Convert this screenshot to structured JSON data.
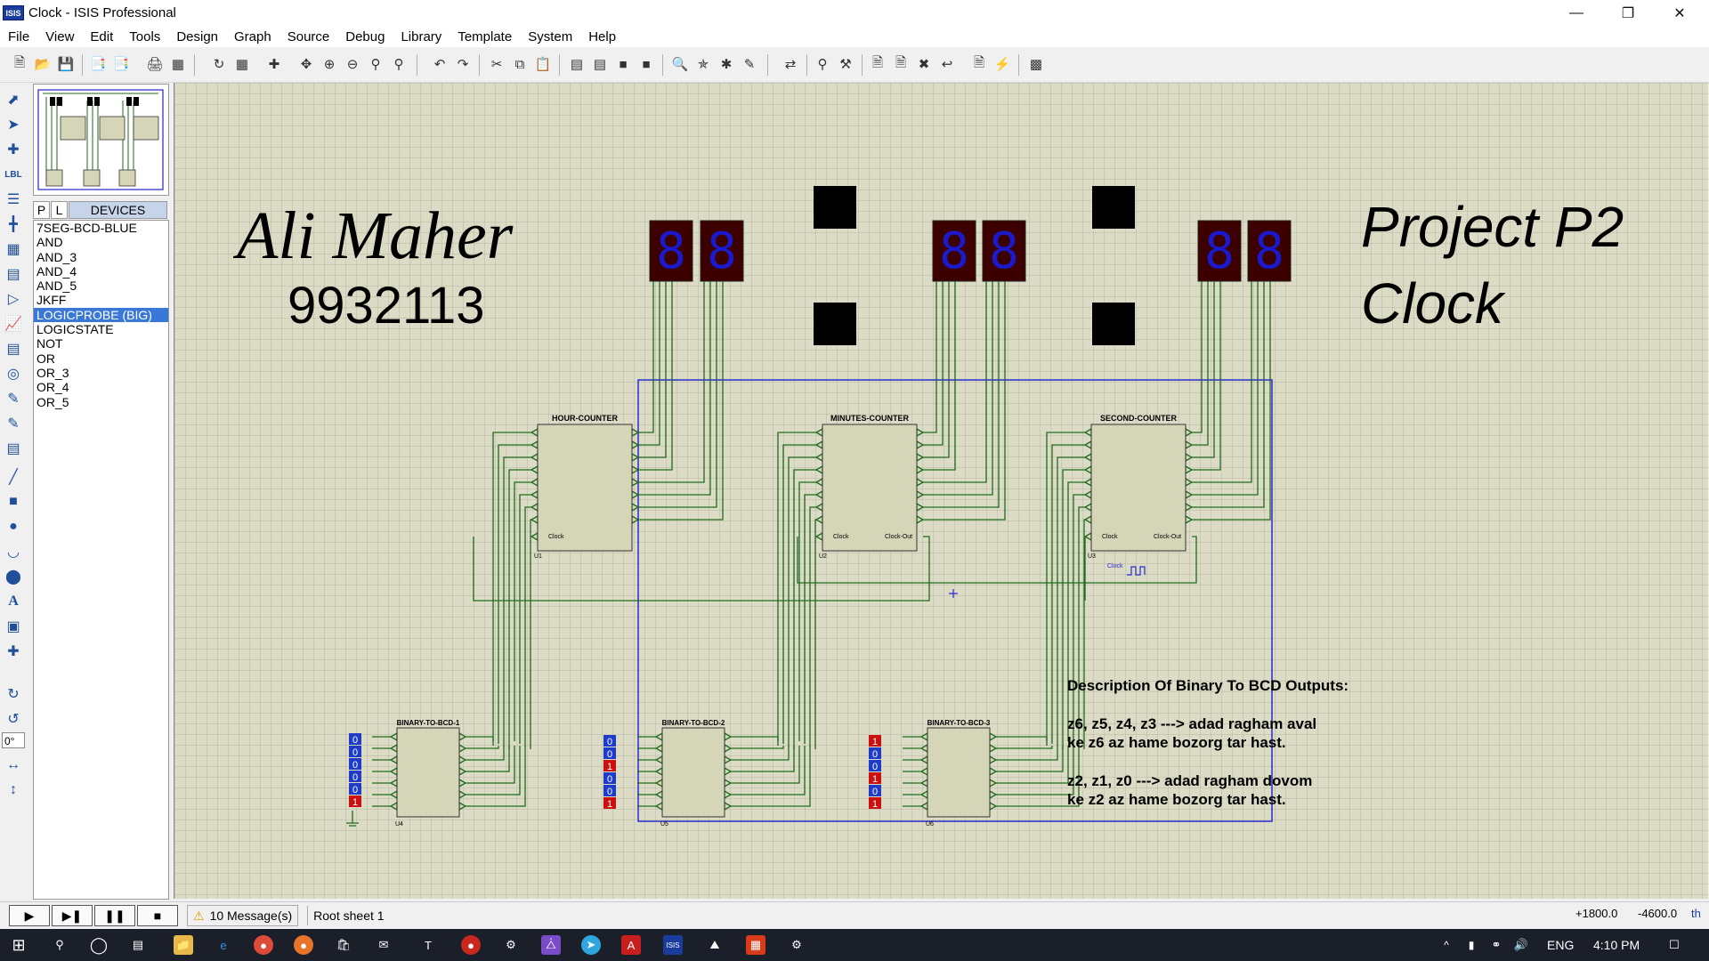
{
  "window": {
    "title": "Clock - ISIS Professional",
    "app_icon": "ISIS"
  },
  "menu": [
    "File",
    "View",
    "Edit",
    "Tools",
    "Design",
    "Graph",
    "Source",
    "Debug",
    "Library",
    "Template",
    "System",
    "Help"
  ],
  "device_panel": {
    "tabs": [
      "P",
      "L"
    ],
    "title": "DEVICES",
    "items": [
      "7SEG-BCD-BLUE",
      "AND",
      "AND_3",
      "AND_4",
      "AND_5",
      "JKFF",
      "LOGICPROBE (BIG)",
      "LOGICSTATE",
      "NOT",
      "OR",
      "OR_3",
      "OR_4",
      "OR_5"
    ],
    "selected": "LOGICPROBE (BIG)"
  },
  "rotation_value": "0°",
  "schematic": {
    "author": "Ali Maher",
    "student_id": "9932113",
    "project_line1": "Project P2",
    "project_line2": "Clock",
    "display_digit": "8",
    "counters": [
      {
        "label": "HOUR-COUNTER",
        "ref": "U1",
        "clock_pin": "Clock"
      },
      {
        "label": "MINUTES-COUNTER",
        "ref": "U2",
        "clock_pin": "Clock",
        "clock_out": "Clock-Out"
      },
      {
        "label": "SECOND-COUNTER",
        "ref": "U3",
        "clock_pin": "Clock",
        "clock_out": "Clock-Out",
        "generator_label": "Clock"
      }
    ],
    "converters": [
      {
        "label": "BINARY-TO-BCD-1",
        "ref": "U4",
        "states": [
          "0",
          "0",
          "0",
          "0",
          "0",
          "1"
        ]
      },
      {
        "label": "BINARY-TO-BCD-2",
        "ref": "U5",
        "states": [
          "0",
          "0",
          "1",
          "0",
          "0",
          "1"
        ]
      },
      {
        "label": "BINARY-TO-BCD-3",
        "ref": "U6",
        "states": [
          "1",
          "0",
          "0",
          "1",
          "0",
          "1"
        ]
      }
    ],
    "description": {
      "heading": "Description Of Binary To BCD Outputs:",
      "line1": "z6, z5, z4, z3 ---> adad ragham aval",
      "line2": "ke z6 az hame bozorg tar hast.",
      "line3": "z2, z1, z0 ---> adad ragham dovom",
      "line4": "ke z2 az hame bozorg tar hast."
    }
  },
  "status": {
    "messages": "10 Message(s)",
    "sheet": "Root sheet 1",
    "x": "+1800.0",
    "y": "-4600.0",
    "unit": "th"
  },
  "taskbar": {
    "lang": "ENG",
    "time": "4:10 PM"
  },
  "colors": {
    "canvas": "#dcdcc6",
    "wire": "#1e6b1e",
    "box": "#2a2ad0",
    "display_bg": "#3c0000",
    "display_seg": "#1a1acc"
  }
}
